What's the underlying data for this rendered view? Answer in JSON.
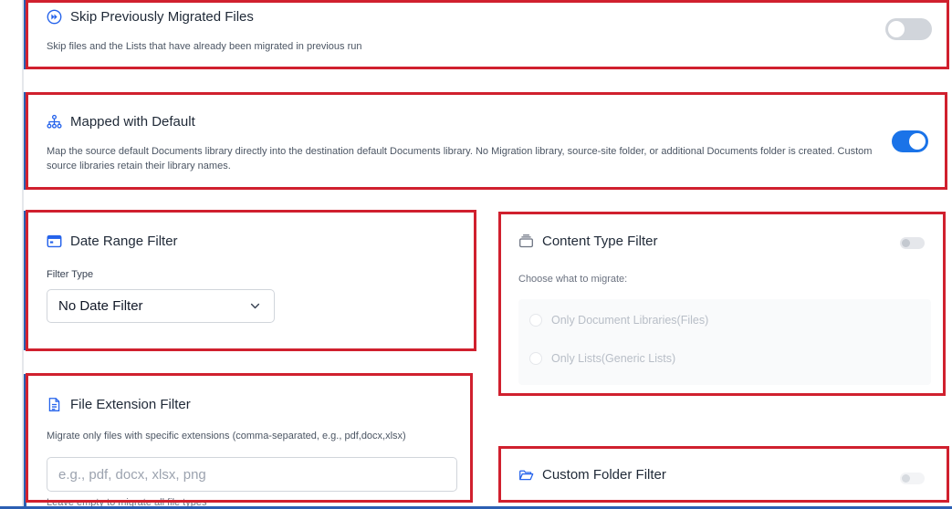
{
  "skip_migrated": {
    "title": "Skip Previously Migrated Files",
    "description": "Skip files and the Lists that have already been migrated in previous run",
    "enabled": false,
    "icon": "skip-forward-icon"
  },
  "mapped_default": {
    "title": "Mapped with Default",
    "description": "Map the source default Documents library directly into the destination default Documents library. No Migration library, source-site folder, or additional Documents folder is created. Custom source libraries retain their library names.",
    "enabled": true,
    "icon": "sitemap-icon"
  },
  "date_range": {
    "title": "Date Range Filter",
    "filter_type_label": "Filter Type",
    "selected": "No Date Filter",
    "icon": "calendar-card-icon"
  },
  "content_type": {
    "title": "Content Type Filter",
    "description": "Choose what to migrate:",
    "enabled": false,
    "options": [
      "Only Document Libraries(Files)",
      "Only Lists(Generic Lists)"
    ],
    "icon": "stack-icon"
  },
  "file_extension": {
    "title": "File Extension Filter",
    "description": "Migrate only files with specific extensions (comma-separated, e.g., pdf,docx,xlsx)",
    "placeholder": "e.g., pdf, docx, xlsx, png",
    "hint": "Leave empty to migrate all file types",
    "icon": "document-icon"
  },
  "custom_folder": {
    "title": "Custom Folder Filter",
    "enabled": false,
    "icon": "folder-open-icon"
  },
  "colors": {
    "accent": "#1a73e8",
    "highlight": "#d0202e",
    "toggle_off": "#d1d5db"
  }
}
